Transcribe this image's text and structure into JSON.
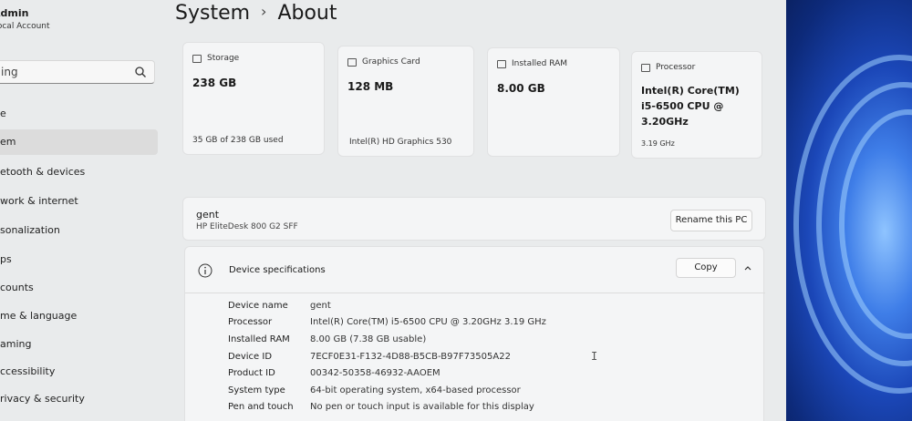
{
  "account": {
    "name": "Admin",
    "type": "Local Account"
  },
  "sidebar": {
    "search_text": "ing",
    "items": [
      {
        "label": "e",
        "selected": false
      },
      {
        "label": "em",
        "selected": true
      },
      {
        "label": "etooth & devices",
        "selected": false
      },
      {
        "label": "work & internet",
        "selected": false
      },
      {
        "label": "sonalization",
        "selected": false
      },
      {
        "label": "ps",
        "selected": false
      },
      {
        "label": "counts",
        "selected": false
      },
      {
        "label": "me & language",
        "selected": false
      },
      {
        "label": "aming",
        "selected": false
      },
      {
        "label": "ccessibility",
        "selected": false
      },
      {
        "label": "rivacy & security",
        "selected": false
      }
    ]
  },
  "header": {
    "section": "System",
    "page": "About"
  },
  "cards": [
    {
      "title": "Storage",
      "value": "238 GB",
      "sub": "35 GB of 238 GB used",
      "icon": "storage-icon"
    },
    {
      "title": "Graphics Card",
      "value": "128 MB",
      "sub": "Intel(R) HD Graphics 530",
      "icon": "graphics-card-icon"
    },
    {
      "title": "Installed RAM",
      "value": "8.00 GB",
      "sub": "",
      "icon": "ram-icon"
    },
    {
      "title": "Processor",
      "value": "Intel(R) Core(TM) i5-6500 CPU @ 3.20GHz",
      "sub": "3.19 GHz",
      "icon": "processor-icon"
    }
  ],
  "device": {
    "name": "gent",
    "model": "HP EliteDesk 800 G2 SFF",
    "rename_label": "Rename this PC"
  },
  "specs": {
    "title": "Device specifications",
    "copy_label": "Copy",
    "rows": [
      {
        "key": "Device name",
        "value": "gent"
      },
      {
        "key": "Processor",
        "value": "Intel(R) Core(TM) i5-6500 CPU @ 3.20GHz   3.19 GHz"
      },
      {
        "key": "Installed RAM",
        "value": "8.00 GB (7.38 GB usable)"
      },
      {
        "key": "Device ID",
        "value": "7ECF0E31-F132-4D88-B5CB-B97F73505A22"
      },
      {
        "key": "Product ID",
        "value": "00342-50358-46932-AAOEM"
      },
      {
        "key": "System type",
        "value": "64-bit operating system, x64-based processor"
      },
      {
        "key": "Pen and touch",
        "value": "No pen or touch input is available for this display"
      }
    ]
  }
}
